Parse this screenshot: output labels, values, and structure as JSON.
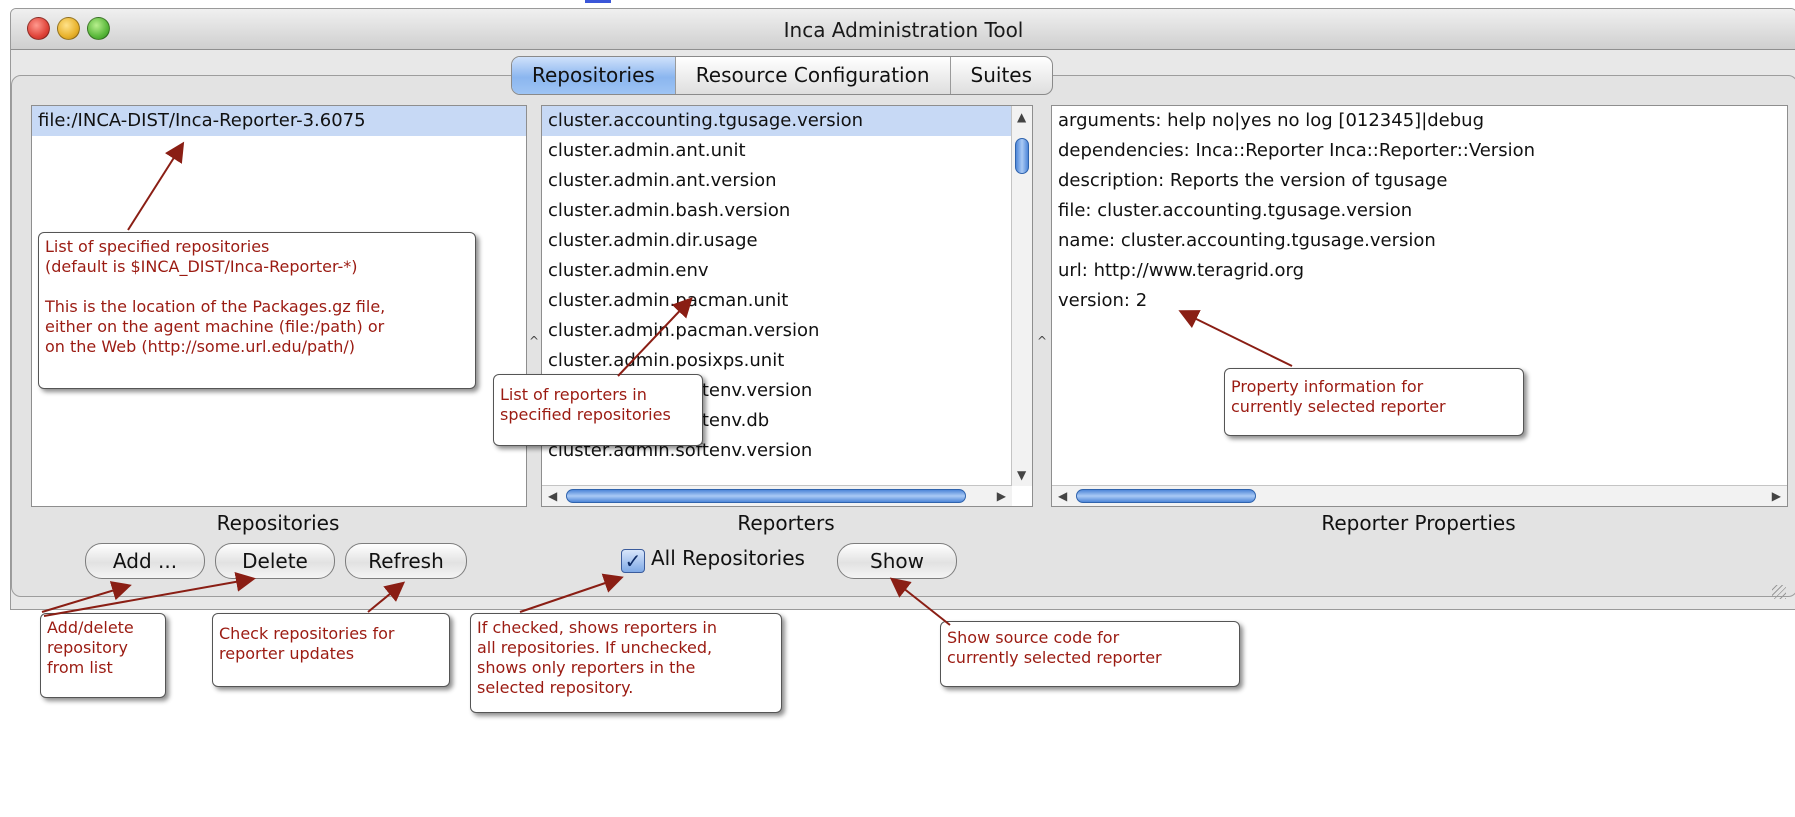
{
  "window": {
    "title": "Inca Administration Tool"
  },
  "tabs": [
    {
      "label": "Repositories",
      "active": true
    },
    {
      "label": "Resource Configuration",
      "active": false
    },
    {
      "label": "Suites",
      "active": false
    }
  ],
  "repositories": {
    "items": [
      "file:/INCA-DIST/Inca-Reporter-3.6075"
    ],
    "caption": "Repositories",
    "buttons": {
      "add": "Add ...",
      "delete": "Delete",
      "refresh": "Refresh"
    }
  },
  "reporters": {
    "items": [
      "cluster.accounting.tgusage.version",
      "cluster.admin.ant.unit",
      "cluster.admin.ant.version",
      "cluster.admin.bash.version",
      "cluster.admin.dir.usage",
      "cluster.admin.env",
      "cluster.admin.pacman.unit",
      "cluster.admin.pacman.version",
      "cluster.admin.posixps.unit",
      "cluster.admin.softenv.version",
      "cluster.admin.softenv.db",
      "cluster.admin.softenv.version"
    ],
    "caption": "Reporters",
    "all_repositories_label": "All Repositories",
    "all_repositories_checked": true,
    "show_label": "Show"
  },
  "properties": {
    "items": [
      "arguments:    help no|yes no   log [012345]|debug",
      "dependencies:  Inca::Reporter  Inca::Reporter::Version",
      "description: Reports the version of tgusage",
      "file: cluster.accounting.tgusage.version",
      "name: cluster.accounting.tgusage.version",
      "url: http://www.teragrid.org",
      "version: 2"
    ],
    "caption": "Reporter Properties"
  },
  "annotations": {
    "repos_list": "List of specified repositories\n(default is $INCA_DIST/Inca-Reporter-*)\n\nThis is the location of the Packages.gz file,\neither on the agent machine (file:/path) or\non the Web (http://some.url.edu/path/)",
    "reporters_list": "List of reporters in\nspecified repositories",
    "property_info": "Property information for\ncurrently selected reporter",
    "add_delete": "Add/delete\nrepository\nfrom list",
    "check_repos": "Check repositories for\nreporter updates",
    "if_checked": "If checked, shows reporters in\nall repositories.  If unchecked,\nshows only reporters in the\nselected repository.",
    "show_source": "Show source code for\ncurrently selected reporter"
  },
  "colors": {
    "annotation_text": "#9b1b12",
    "selection": "#c7d9f5",
    "tab_active": "#8bb6ef"
  }
}
